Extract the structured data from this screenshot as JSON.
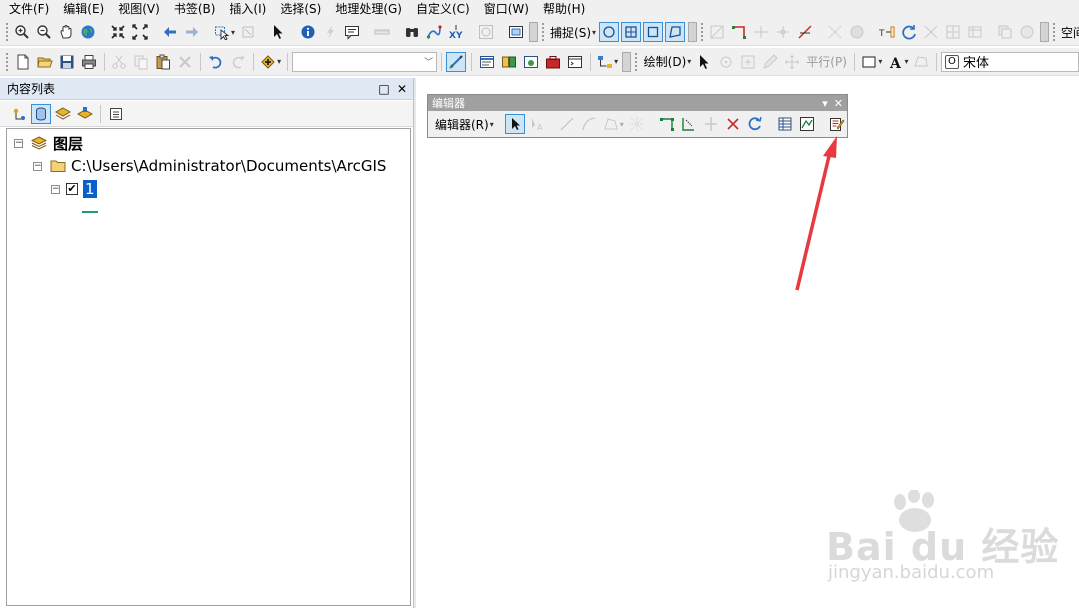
{
  "menubar": {
    "items": [
      "文件(F)",
      "编辑(E)",
      "视图(V)",
      "书签(B)",
      "插入(I)",
      "选择(S)",
      "地理处理(G)",
      "自定义(C)",
      "窗口(W)",
      "帮助(H)"
    ]
  },
  "toolbar1": {
    "snapping_label": "捕捉(S)",
    "space_label": "空间"
  },
  "toolbar2": {
    "draw_label": "绘制(D)",
    "parallel_label": "平行(P)",
    "font_name": "宋体"
  },
  "toc": {
    "title": "内容列表",
    "root_label": "图层",
    "folder_path": "C:\\Users\\Administrator\\Documents\\ArcGIS",
    "layer_name": "1",
    "layer_checked": true
  },
  "editor": {
    "window_title": "编辑器",
    "menu_label": "编辑器(R)"
  },
  "annotation": {
    "arrow_color": "#e8393e"
  },
  "watermark": {
    "brand": "Bai du 经验",
    "url": "jingyan.baidu.com"
  }
}
